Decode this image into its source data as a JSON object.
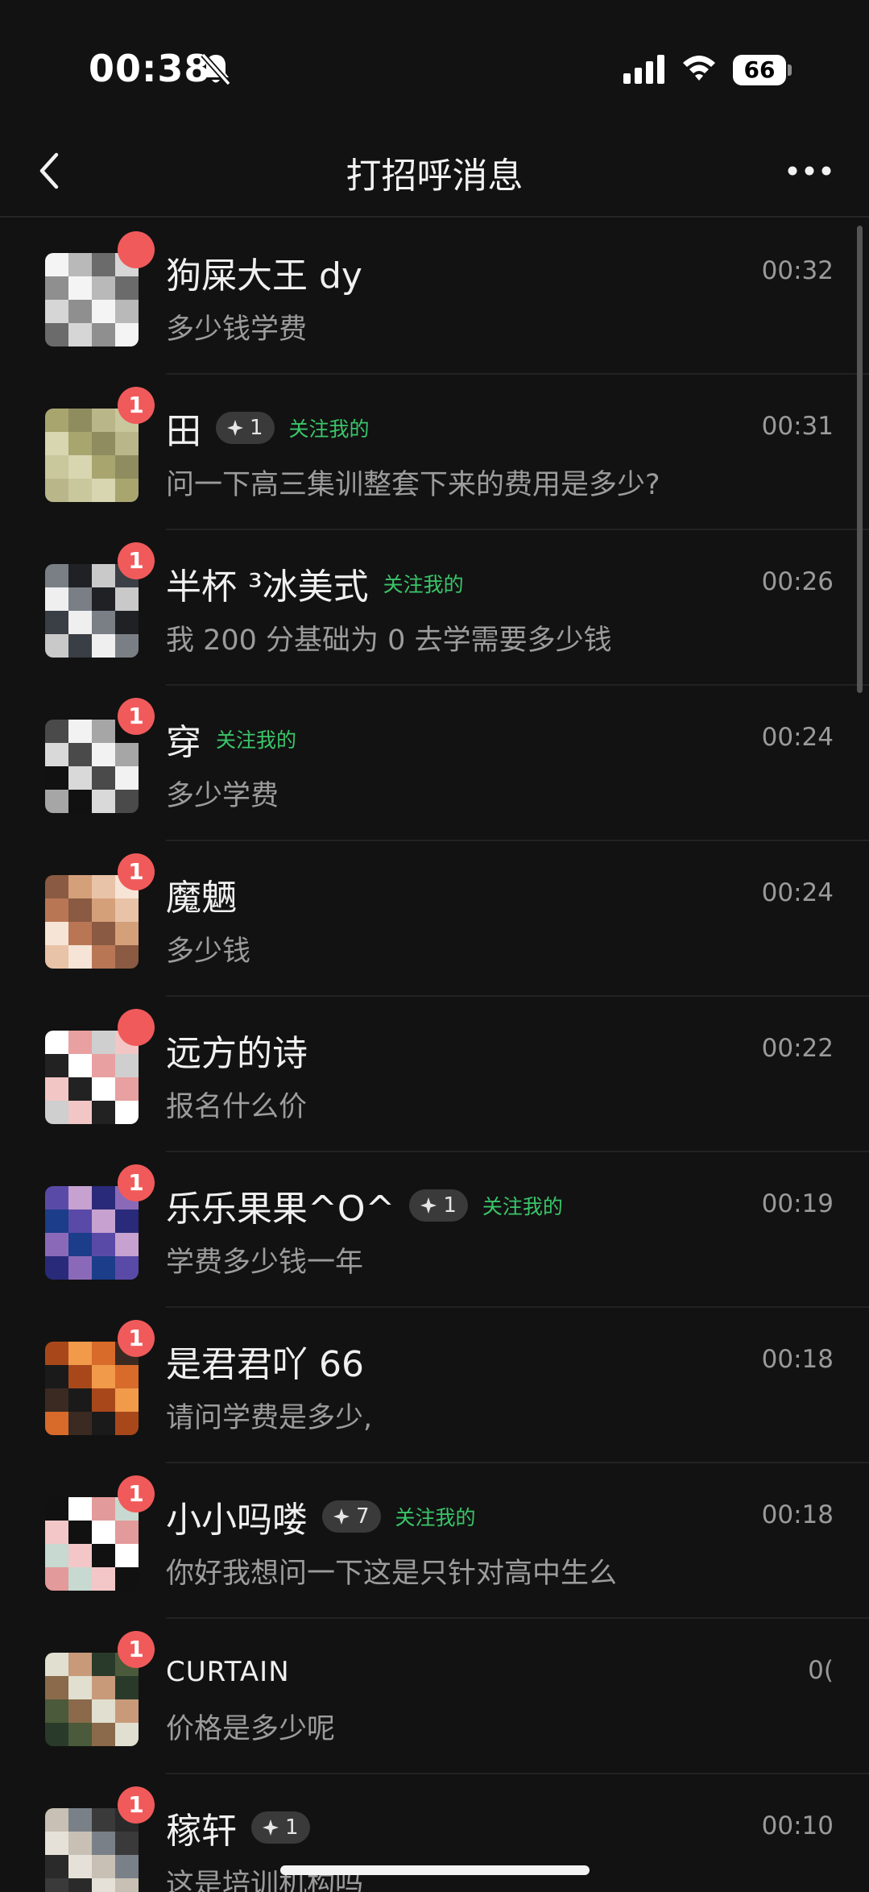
{
  "status_bar": {
    "time": "00:38",
    "battery": "66",
    "icons": [
      "bell-slash-icon",
      "cellular-signal-icon",
      "wifi-icon",
      "battery-icon"
    ]
  },
  "nav": {
    "title": "打招呼消息",
    "back_icon": "chevron-left-icon",
    "more_icon": "more-horizontal-icon"
  },
  "colors": {
    "background": "#121212",
    "badge": "#f15a5a",
    "follow_tag": "#3ac569",
    "pill": "#3a3a3a"
  },
  "messages": [
    {
      "name": "狗屎大王 dy",
      "time": "00:32",
      "preview": "多少钱学费",
      "badge": "",
      "spark": "",
      "follow": ""
    },
    {
      "name": "田",
      "time": "00:31",
      "preview": "问一下高三集训整套下来的费用是多少?",
      "badge": "1",
      "spark": "1",
      "follow": "关注我的"
    },
    {
      "name": "半杯 ³冰美式",
      "time": "00:26",
      "preview": "我 200 分基础为 0 去学需要多少钱",
      "badge": "1",
      "spark": "",
      "follow": "关注我的"
    },
    {
      "name": "穿",
      "time": "00:24",
      "preview": "多少学费",
      "badge": "1",
      "spark": "",
      "follow": "关注我的"
    },
    {
      "name": "魔魉",
      "time": "00:24",
      "preview": "多少钱",
      "badge": "1",
      "spark": "",
      "follow": ""
    },
    {
      "name": "远方的诗",
      "time": "00:22",
      "preview": "报名什么价",
      "badge": "",
      "spark": "",
      "follow": ""
    },
    {
      "name": "乐乐果果^O^",
      "time": "00:19",
      "preview": "学费多少钱一年",
      "badge": "1",
      "spark": "1",
      "follow": "关注我的"
    },
    {
      "name": "是君君吖 66",
      "time": "00:18",
      "preview": "请问学费是多少,",
      "badge": "1",
      "spark": "",
      "follow": ""
    },
    {
      "name": "小小吗喽",
      "time": "00:18",
      "preview": "你好我想问一下这是只针对高中生么",
      "badge": "1",
      "spark": "7",
      "follow": "关注我的"
    },
    {
      "name": "CURTAIN",
      "time": "0(",
      "preview": "价格是多少呢",
      "badge": "1",
      "spark": "",
      "follow": ""
    },
    {
      "name": "稼轩",
      "time": "00:10",
      "preview": "这是培训机构吗",
      "badge": "1",
      "spark": "1",
      "follow": ""
    }
  ]
}
